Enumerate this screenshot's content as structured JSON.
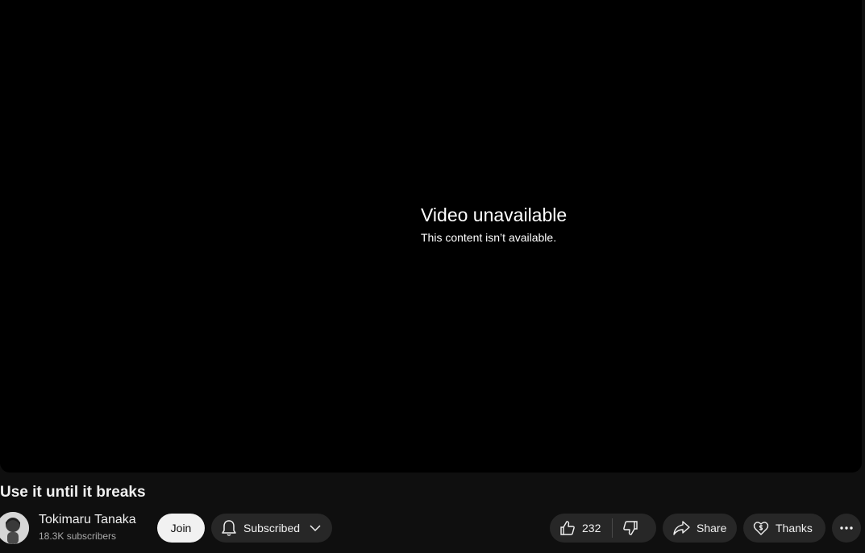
{
  "player": {
    "error_title": "Video unavailable",
    "error_message": "This content isn’t available."
  },
  "video": {
    "title": "Use it until it breaks"
  },
  "channel": {
    "name": "Tokimaru Tanaka",
    "subscribers": "18.3K subscribers",
    "avatar_icon": "avatar-person"
  },
  "actions": {
    "join_label": "Join",
    "subscribed_label": "Subscribed",
    "like_count": "232",
    "share_label": "Share",
    "thanks_label": "Thanks",
    "icons": [
      "bell-icon",
      "chevron-down-icon",
      "thumbs-up-icon",
      "thumbs-down-icon",
      "share-arrow-icon",
      "heart-dollar-icon",
      "more-horizontal-icon"
    ]
  },
  "colors": {
    "background": "#0f0f0f",
    "player": "#000000",
    "pill": "#272727",
    "join_bg": "#f1f1f1",
    "text": "#f1f1f1",
    "muted_text": "#aaaaaa"
  }
}
